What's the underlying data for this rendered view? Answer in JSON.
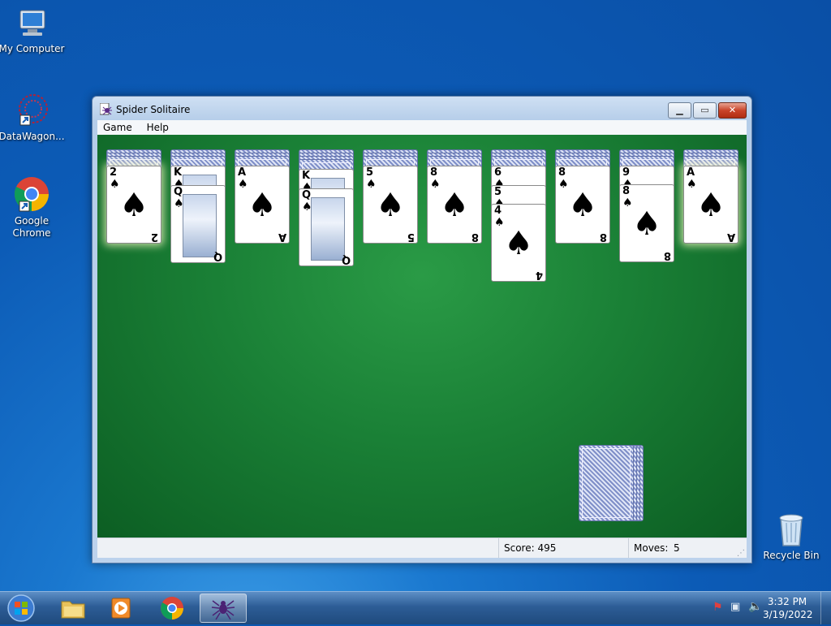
{
  "desktop": {
    "icons": [
      {
        "label": "My Computer"
      },
      {
        "label": "DataWagon..."
      },
      {
        "label": "Google Chrome"
      },
      {
        "label": "Recycle Bin"
      }
    ]
  },
  "window": {
    "title": "Spider Solitaire",
    "menu": [
      "Game",
      "Help"
    ],
    "status": {
      "score_label": "Score: 495",
      "moves_label": "Moves:",
      "moves_value": "5"
    }
  },
  "tableau": [
    {
      "face_down": 3,
      "visible": [
        {
          "rank": "2",
          "suit": "♠"
        }
      ]
    },
    {
      "face_down": 3,
      "visible": [
        {
          "rank": "K",
          "suit": "♠"
        },
        {
          "rank": "Q",
          "suit": "♠"
        }
      ]
    },
    {
      "face_down": 3,
      "visible": [
        {
          "rank": "A",
          "suit": "♠"
        }
      ]
    },
    {
      "face_down": 4,
      "visible": [
        {
          "rank": "K",
          "suit": "♠"
        },
        {
          "rank": "Q",
          "suit": "♠"
        }
      ]
    },
    {
      "face_down": 3,
      "visible": [
        {
          "rank": "5",
          "suit": "♠"
        }
      ]
    },
    {
      "face_down": 3,
      "visible": [
        {
          "rank": "8",
          "suit": "♠"
        }
      ]
    },
    {
      "face_down": 3,
      "visible": [
        {
          "rank": "6",
          "suit": "♠"
        },
        {
          "rank": "5",
          "suit": "♠"
        },
        {
          "rank": "4",
          "suit": "♠"
        }
      ]
    },
    {
      "face_down": 3,
      "visible": [
        {
          "rank": "8",
          "suit": "♠"
        }
      ]
    },
    {
      "face_down": 3,
      "visible": [
        {
          "rank": "9",
          "suit": "♠"
        },
        {
          "rank": "8",
          "suit": "♠"
        }
      ]
    },
    {
      "face_down": 3,
      "visible": [
        {
          "rank": "A",
          "suit": "♠"
        }
      ]
    }
  ],
  "stock": {
    "piles": 4
  },
  "taskbar": {
    "clock_time": "3:32 PM",
    "clock_date": "3/19/2022"
  },
  "colors": {
    "felt": "#1a8036",
    "card_back": "#7f8fc8"
  }
}
